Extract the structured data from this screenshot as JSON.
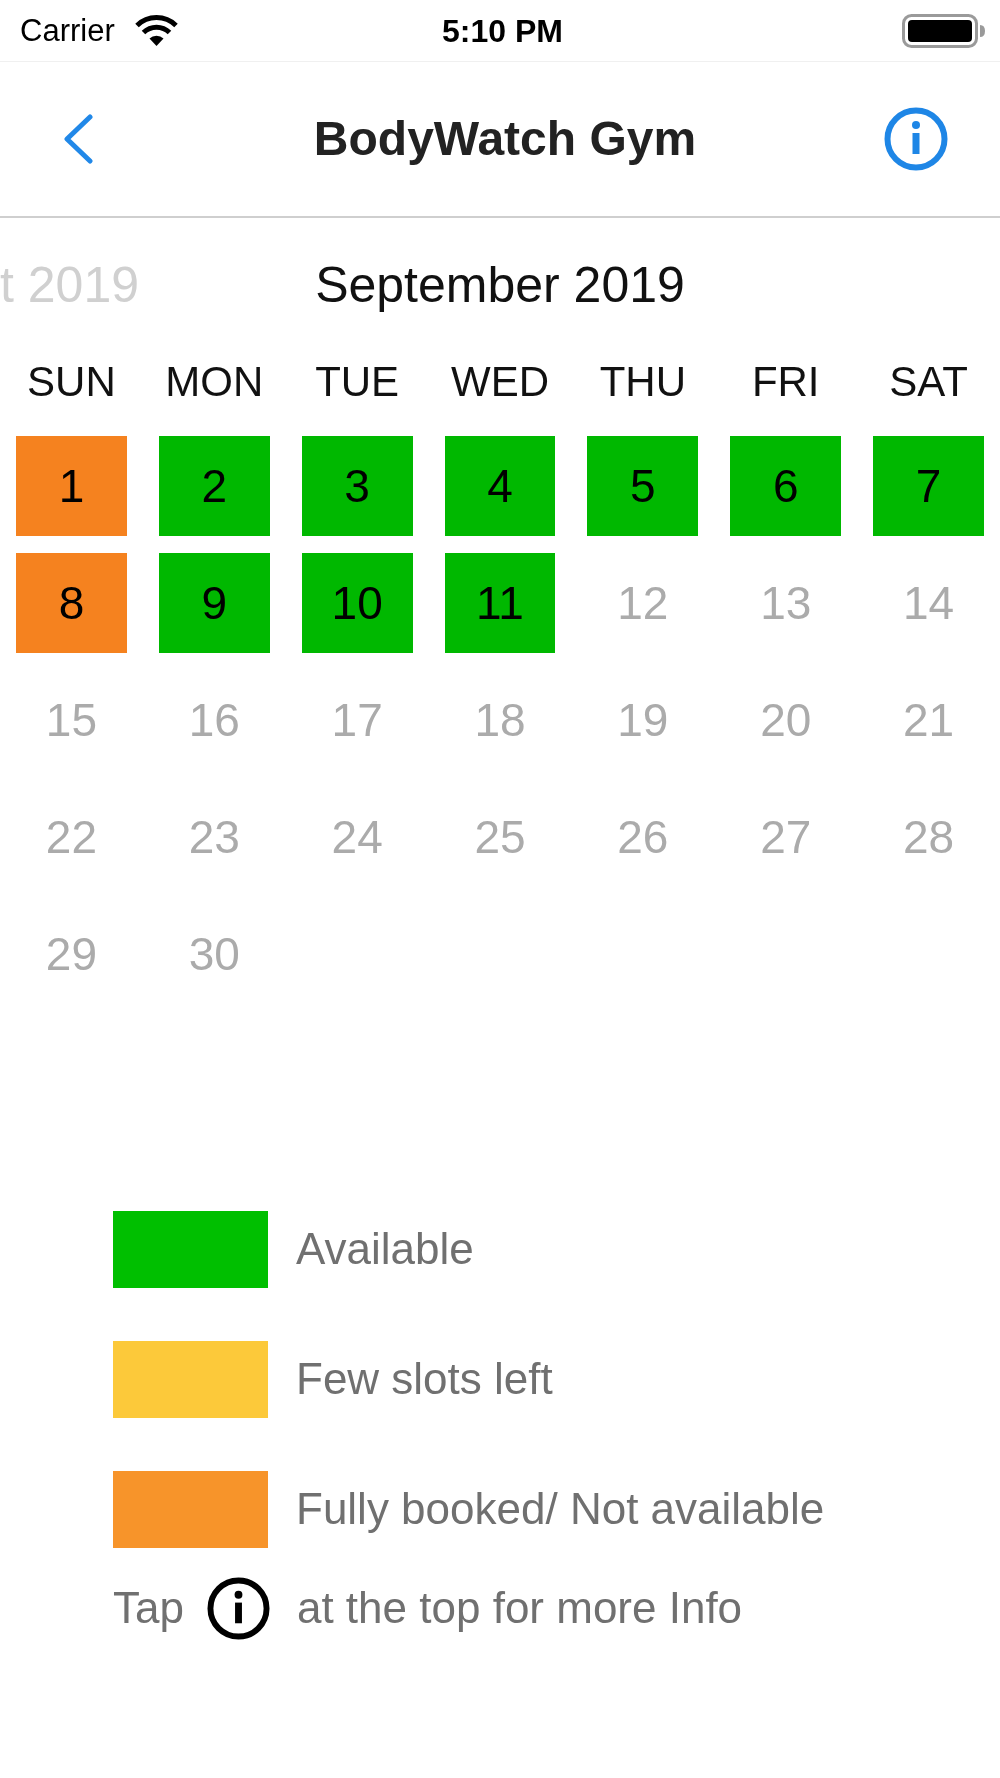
{
  "status_bar": {
    "carrier": "Carrier",
    "time": "5:10 PM"
  },
  "nav_bar": {
    "title": "BodyWatch Gym"
  },
  "calendar": {
    "previous_month": "t 2019",
    "month": "September 2019",
    "weekdays": [
      "SUN",
      "MON",
      "TUE",
      "WED",
      "THU",
      "FRI",
      "SAT"
    ],
    "days": [
      {
        "label": "1",
        "color": "#f5821f"
      },
      {
        "label": "2",
        "color": "#00b800"
      },
      {
        "label": "3",
        "color": "#00b800"
      },
      {
        "label": "4",
        "color": "#00b800"
      },
      {
        "label": "5",
        "color": "#00b800"
      },
      {
        "label": "6",
        "color": "#00b800"
      },
      {
        "label": "7",
        "color": "#00b800"
      },
      {
        "label": "8",
        "color": "#f5821f"
      },
      {
        "label": "9",
        "color": "#00b800"
      },
      {
        "label": "10",
        "color": "#00b800"
      },
      {
        "label": "11",
        "color": "#00b800"
      },
      {
        "label": "12"
      },
      {
        "label": "13"
      },
      {
        "label": "14"
      },
      {
        "label": "15"
      },
      {
        "label": "16"
      },
      {
        "label": "17"
      },
      {
        "label": "18"
      },
      {
        "label": "19"
      },
      {
        "label": "20"
      },
      {
        "label": "21"
      },
      {
        "label": "22"
      },
      {
        "label": "23"
      },
      {
        "label": "24"
      },
      {
        "label": "25"
      },
      {
        "label": "26"
      },
      {
        "label": "27"
      },
      {
        "label": "28"
      },
      {
        "label": "29"
      },
      {
        "label": "30"
      }
    ]
  },
  "legend": {
    "items": [
      {
        "label": "Available",
        "color": "#00bf00"
      },
      {
        "label": "Few slots left",
        "color": "#fcc93a"
      },
      {
        "label": "Fully booked/ Not available",
        "color": "#f7942a"
      }
    ],
    "hint": {
      "before": "Tap",
      "after": "at the top for more Info"
    }
  }
}
